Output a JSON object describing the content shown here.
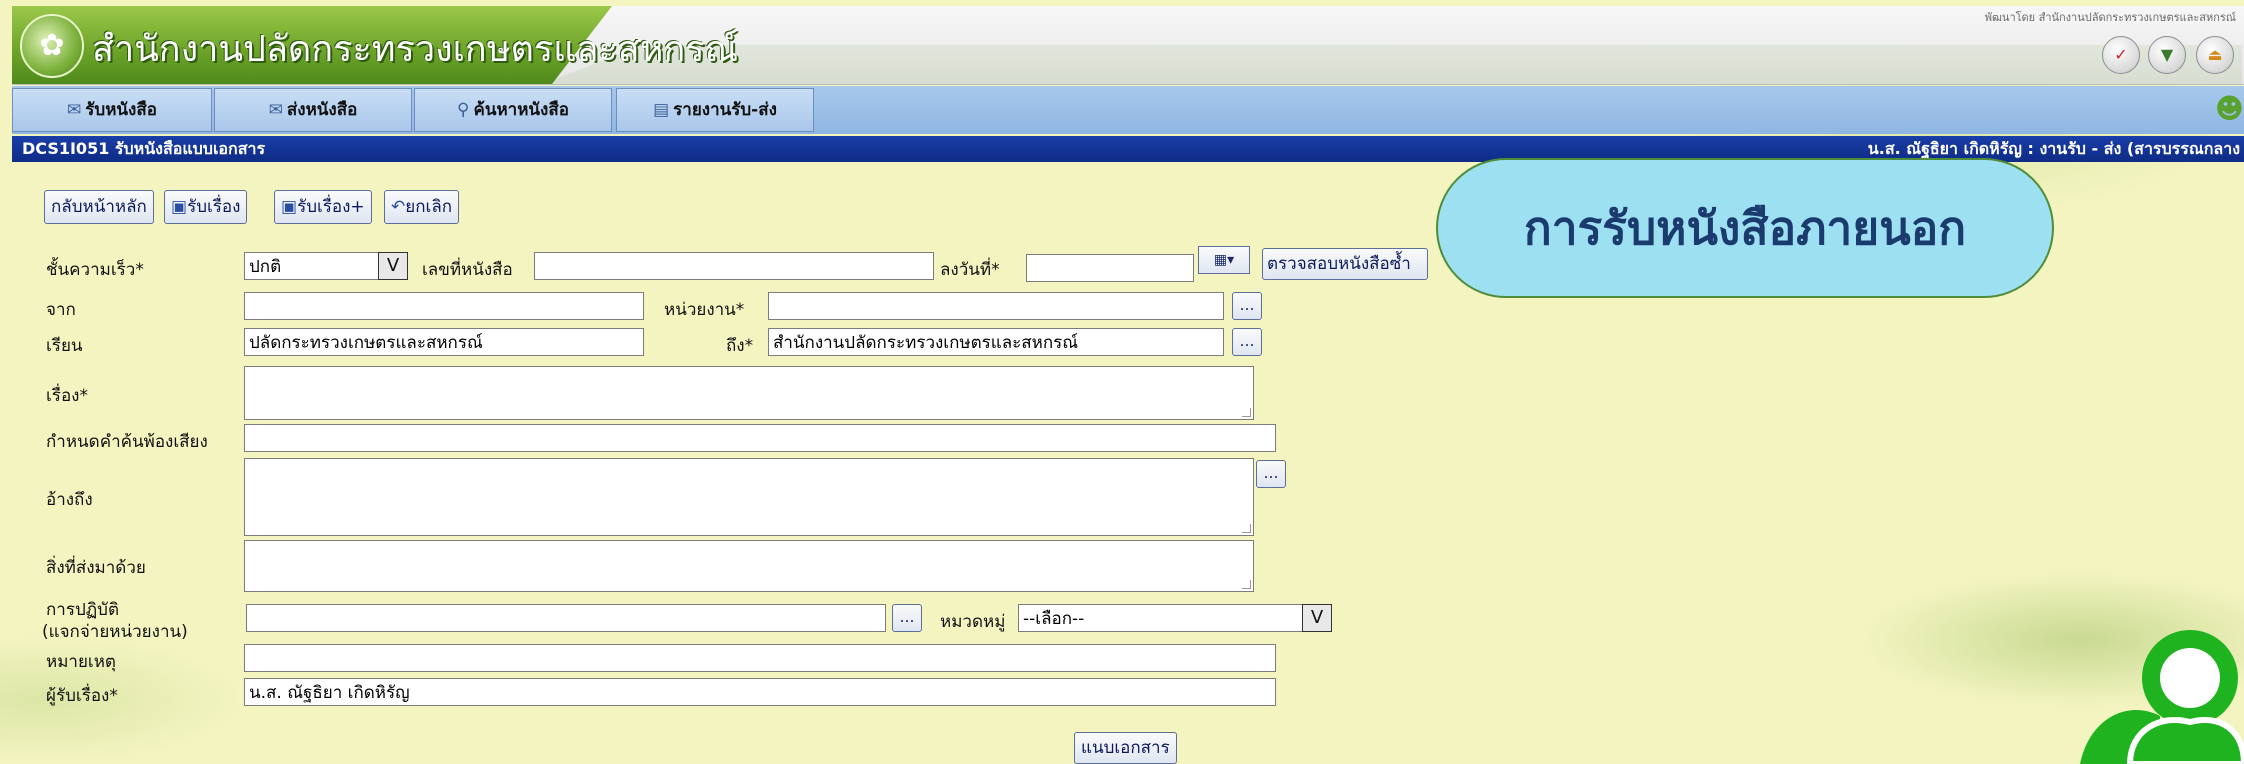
{
  "header": {
    "org_title": "สำนักงานปลัดกระทรวงเกษตรและสหกรณ์",
    "top_right_small": "พัฒนาโดย สำนักงานปลัดกระทรวงเกษตรและสหกรณ์"
  },
  "menu": {
    "items": [
      {
        "label": "รับหนังสือ"
      },
      {
        "label": "ส่งหนังสือ"
      },
      {
        "label": "ค้นหาหนังสือ"
      },
      {
        "label": "รายงานรับ-ส่ง"
      }
    ]
  },
  "titlebar": {
    "left": "DCS1I051 รับหนังสือแบบเอกสาร",
    "right": "น.ส. ณัฐธิยา เกิดหิรัญ : งานรับ - ส่ง (สารบรรณกลาง"
  },
  "toolbar": {
    "home_label": "กลับหน้าหลัก",
    "receive_label": "รับเรื่อง",
    "receive_plus_label": "รับเรื่อง+",
    "cancel_label": "ยกเลิก"
  },
  "form": {
    "urgency_label": "ชั้นความเร็ว*",
    "urgency_value": "ปกติ",
    "docno_label": "เลขที่หนังสือ",
    "docno_value": "",
    "date_label": "ลงวันที่*",
    "date_value": "",
    "check_button_label": "ตรวจสอบหนังสือซ้ำ",
    "from_label": "จาก",
    "from_value": "",
    "unit_label": "หน่วยงาน*",
    "unit_value": "",
    "to_title_label": "เรียน",
    "to_title_value": "ปลัดกระทรวงเกษตรและสหกรณ์",
    "to_label": "ถึง*",
    "to_value": "สำนักงานปลัดกระทรวงเกษตรและสหกรณ์",
    "subject_label": "เรื่อง*",
    "keyword_label": "กำหนดคำค้นพ้องเสียง",
    "reference_label": "อ้างถึง",
    "attach_label": "สิ่งที่ส่งมาด้วย",
    "action_label": "การปฏิบัติ",
    "action_sublabel": "(แจกจ่ายหน่วยงาน)",
    "category_label": "หมวดหมู่",
    "category_value": "--เลือก--",
    "note_label": "หมายเหตุ",
    "receiver_label": "ผู้รับเรื่อง*",
    "receiver_value": "น.ส. ณัฐธิยา เกิดหิรัญ",
    "attach_doc_button": "แนบเอกสาร"
  },
  "callout": {
    "text": "การรับหนังสือภายนอก"
  },
  "colors": {
    "titlebar_bg": "#0e2b86",
    "menu_bg": "#a7c8ec",
    "page_bg": "#f3f4c0",
    "callout_bg": "#9de0f1",
    "brand_green": "#6ea52a",
    "user_icon_green": "#1fb31f"
  },
  "icons": {
    "receive": "mail-in-icon",
    "send": "mail-out-icon",
    "search": "magnifier-icon",
    "report": "report-icon",
    "save": "floppy-icon",
    "undo": "undo-icon",
    "calendar": "calendar-icon",
    "user": "user-icon"
  }
}
